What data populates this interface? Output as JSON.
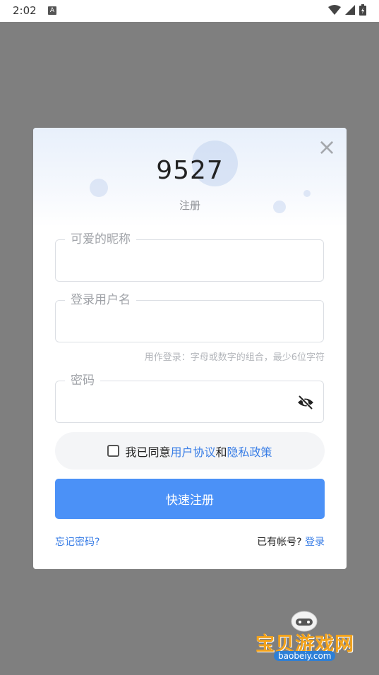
{
  "status_bar": {
    "time": "2:02",
    "notif_icon": "A"
  },
  "dialog": {
    "title": "9527",
    "subtitle": "注册",
    "close_icon": "×",
    "nickname": {
      "label": "可爱的昵称",
      "value": ""
    },
    "username": {
      "label": "登录用户名",
      "value": "",
      "hint": "用作登录：字母或数字的组合，最少6位字符"
    },
    "password": {
      "label": "密码",
      "value": ""
    },
    "agreement": {
      "prefix": "我已同意",
      "user_agreement": "用户协议",
      "and": "和",
      "privacy_policy": "隐私政策",
      "checked": false
    },
    "submit_label": "快速注册",
    "forgot_label": "忘记密码?",
    "have_account": "已有帐号?",
    "login_label": "登录"
  },
  "watermark": {
    "text": "宝贝游戏网",
    "url": "baobeiy.com"
  },
  "colors": {
    "primary": "#4b91f7",
    "link": "#3a7ee6",
    "overlay": "#7f7f7f"
  }
}
